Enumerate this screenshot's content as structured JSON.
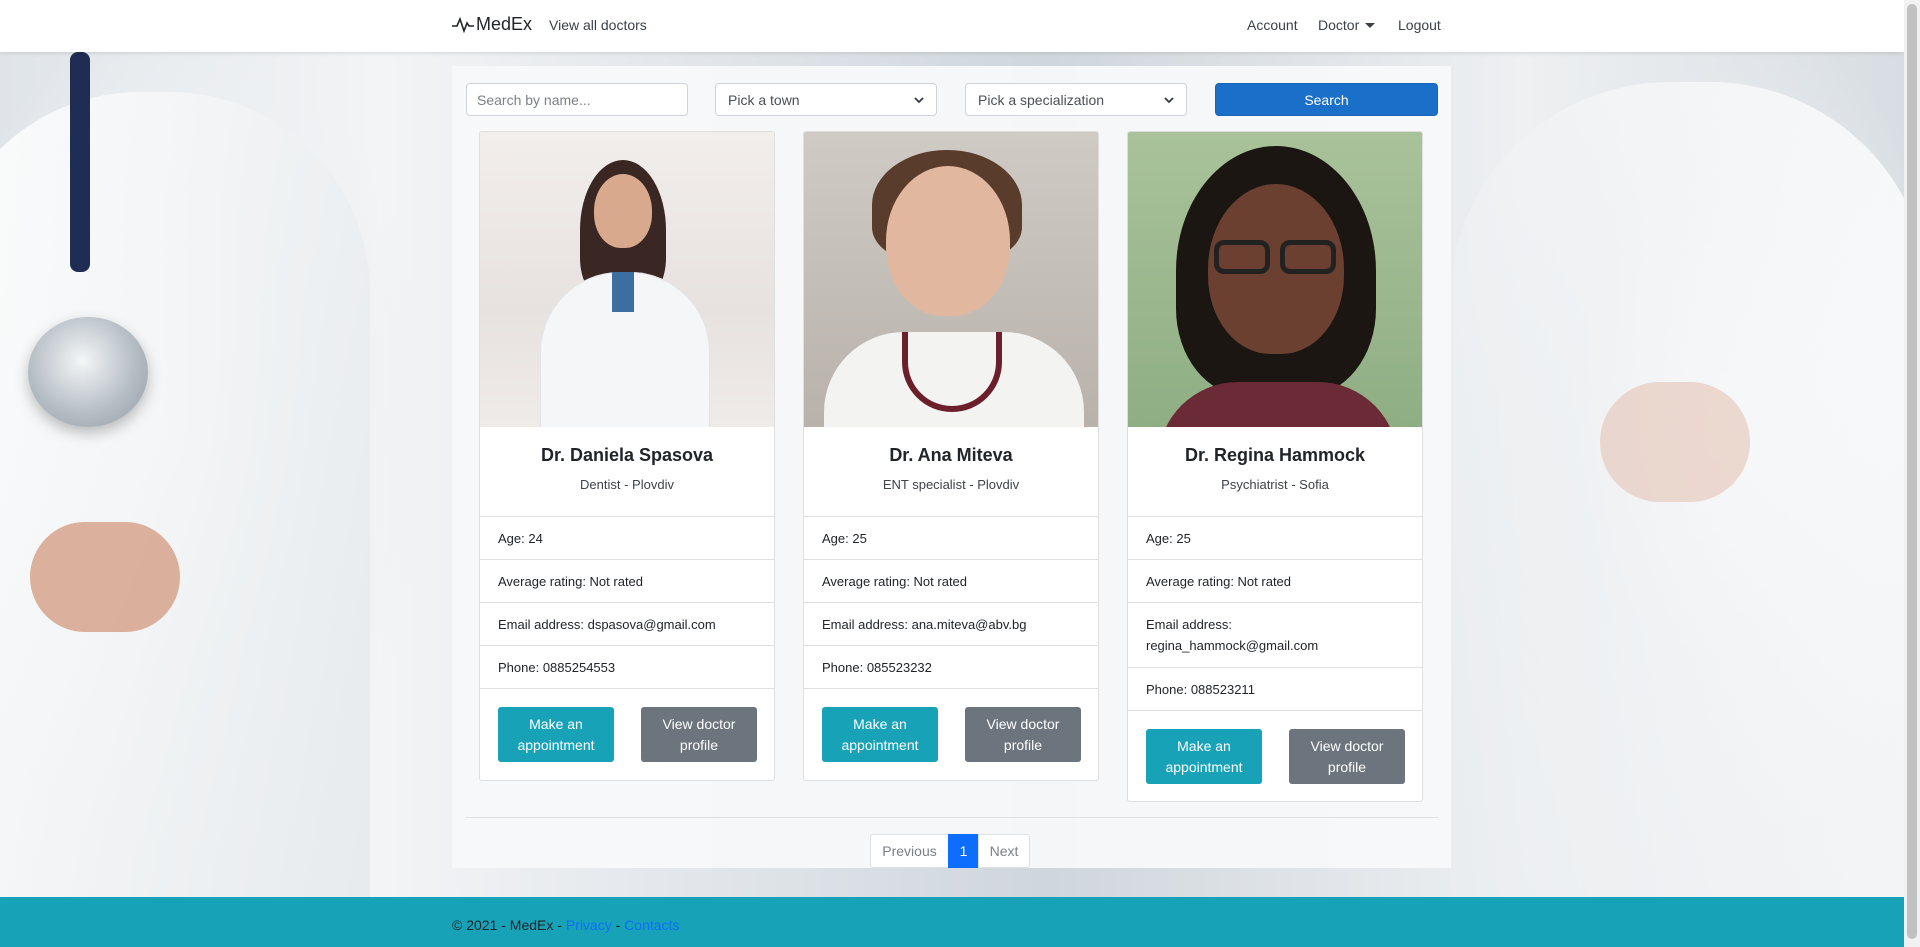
{
  "navbar": {
    "brand": "MedEx",
    "view_all": "View all doctors",
    "account": "Account",
    "doctor": "Doctor",
    "logout": "Logout"
  },
  "search": {
    "name_placeholder": "Search by name...",
    "town_selected": "Pick a town",
    "spec_selected": "Pick a specialization",
    "button": "Search"
  },
  "doctors": [
    {
      "name": "Dr. Daniela Spasova",
      "subtitle": "Dentist - Plovdiv",
      "age": "Age: 24",
      "rating": "Average rating: Not rated",
      "email": "Email address: dspasova@gmail.com",
      "phone": "Phone: 0885254553",
      "appt": "Make an appointment",
      "profile": "View doctor profile"
    },
    {
      "name": "Dr. Ana Miteva",
      "subtitle": "ENT specialist - Plovdiv",
      "age": "Age: 25",
      "rating": "Average rating: Not rated",
      "email": "Email address: ana.miteva@abv.bg",
      "phone": "Phone: 085523232",
      "appt": "Make an appointment",
      "profile": "View doctor profile"
    },
    {
      "name": "Dr. Regina Hammock",
      "subtitle": "Psychiatrist - Sofia",
      "age": "Age: 25",
      "rating": "Average rating: Not rated",
      "email": "Email address: regina_hammock@gmail.com",
      "phone": "Phone: 088523211",
      "appt": "Make an appointment",
      "profile": "View doctor profile"
    }
  ],
  "pagination": {
    "previous": "Previous",
    "current": "1",
    "next": "Next"
  },
  "footer": {
    "copyright": "© 2021 - MedEx - ",
    "privacy": "Privacy",
    "separator": " - ",
    "contacts": "Contacts"
  },
  "colors": {
    "primary": "#1a6fc9",
    "info": "#17a2b8",
    "secondary": "#6c757d",
    "page_active": "#0d6efd"
  }
}
